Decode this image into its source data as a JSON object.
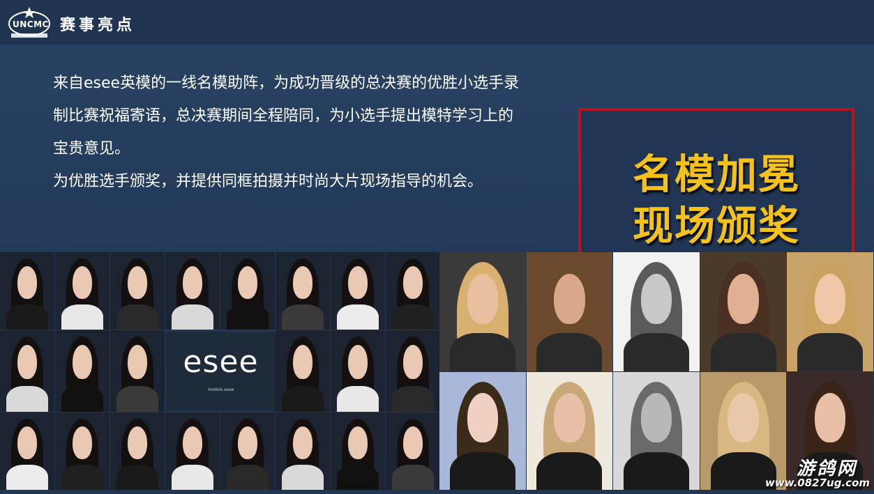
{
  "header": {
    "logo_text": "UNCMC",
    "title": "赛事亮点"
  },
  "body": {
    "paragraph1": "来自esee英模的一线名模助阵，为成功晋级的总决赛的优胜小选手录制比赛祝福寄语，总决赛期间全程陪同，为小选手提出模特学习上的宝贵意见。",
    "paragraph2": " 为优胜选手颁奖，并提供同框拍摄并时尚大片现场指导的机会。"
  },
  "highlight_box": {
    "line1": "名模加冕",
    "line2": "现场颁奖"
  },
  "gallery": {
    "brand_tile_word": "esee",
    "brand_tile_sub": "models.esee"
  },
  "watermark": {
    "site_name": "游鸽网",
    "url": "www.0827ug.com"
  },
  "colors": {
    "background": "#243b55",
    "accent_yellow": "#f4c21b",
    "box_border_red": "#b3151b"
  }
}
